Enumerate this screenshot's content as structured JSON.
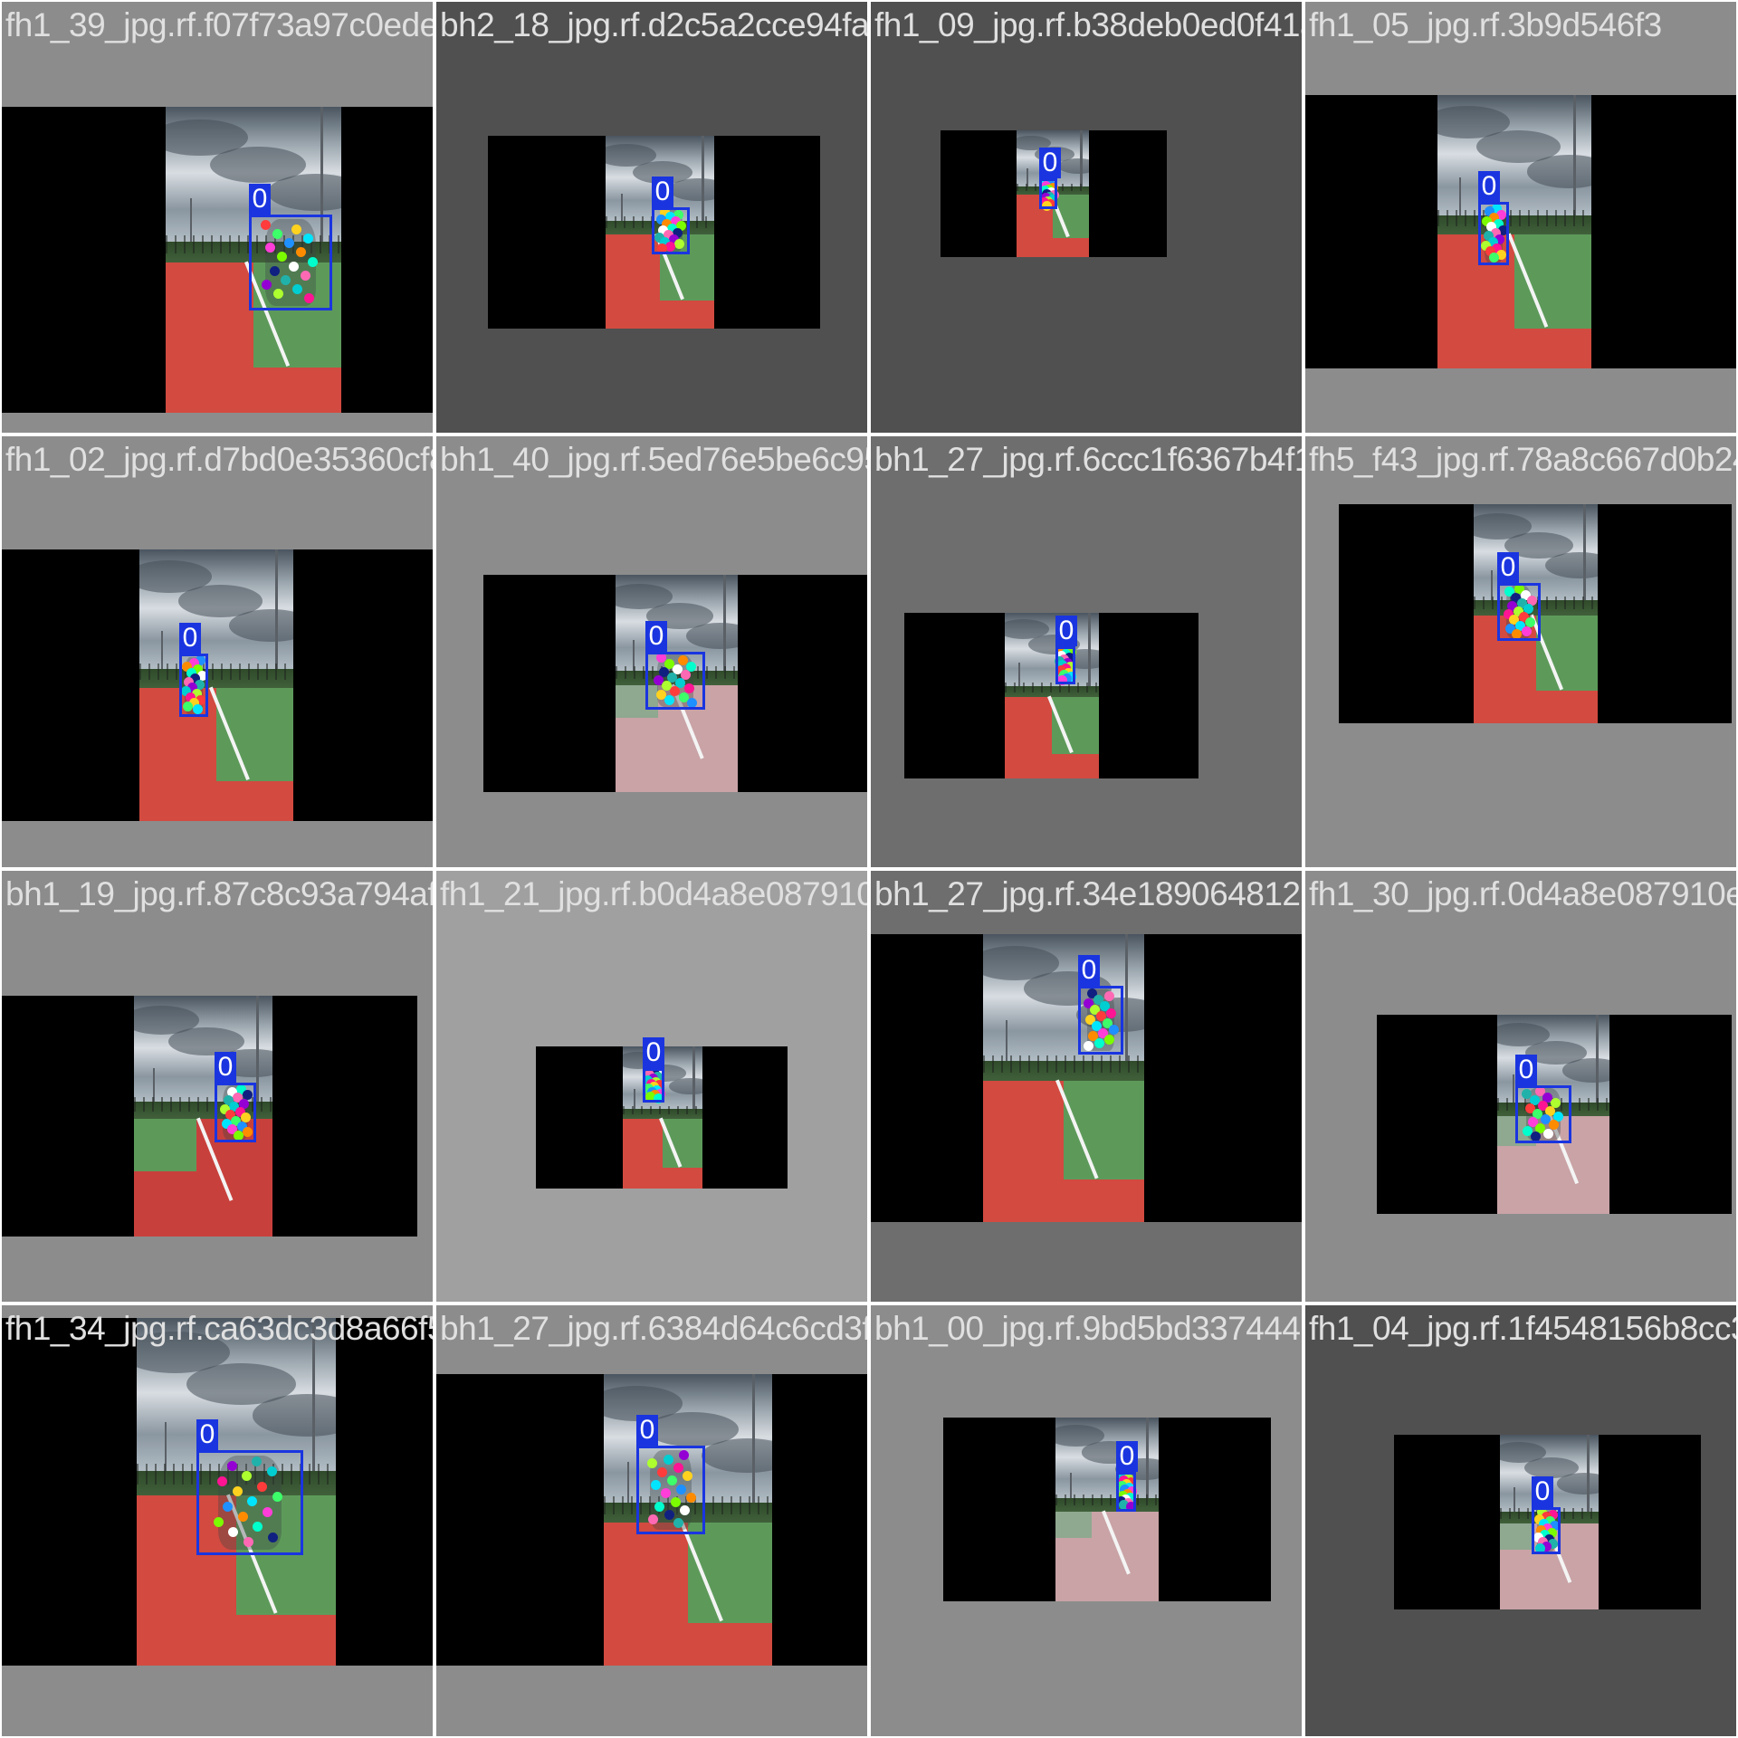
{
  "mosaic": {
    "tiles": [
      {
        "filename": "fh1_39_jpg.rf.f07f73a97c0ede2b2426341b5",
        "background": "#8c8c8c",
        "detection_label": "0",
        "court": "red-green"
      },
      {
        "filename": "bh2_18_jpg.rf.d2c5a2cce94fab029eab4ffa8f",
        "background": "#505050",
        "detection_label": "0",
        "court": "red-green"
      },
      {
        "filename": "fh1_09_jpg.rf.b38deb0ed0f41a054e2963d",
        "background": "#505050",
        "detection_label": "0",
        "court": "red-green"
      },
      {
        "filename": "fh1_05_jpg.rf.3b9d546f3",
        "background": "#8c8c8c",
        "detection_label": "0",
        "court": "red-green"
      },
      {
        "filename": "fh1_02_jpg.rf.d7bd0e35360cf8d74a5590f47",
        "background": "#8c8c8c",
        "detection_label": "0",
        "court": "red-green"
      },
      {
        "filename": "bh1_40_jpg.rf.5ed76e5be6c95fdff6179f22ef",
        "background": "#8c8c8c",
        "detection_label": "0",
        "court": "pink"
      },
      {
        "filename": "bh1_27_jpg.rf.6ccc1f6367b4f1b5c48a5",
        "background": "#6e6e6e",
        "detection_label": "0",
        "court": "red-green"
      },
      {
        "filename": "fh5_f43_jpg.rf.78a8c667d0b24",
        "background": "#8c8c8c",
        "detection_label": "0",
        "court": "red-green"
      },
      {
        "filename": "bh1_19_jpg.rf.87c8c93a794af2142a74196f0d27b3e28901f",
        "background": "#8c8c8c",
        "detection_label": "0",
        "court": "green-red"
      },
      {
        "filename": "fh1_21_jpg.rf.b0d4a8e087910e738561c",
        "background": "#a0a0a0",
        "detection_label": "0",
        "court": "red-green"
      },
      {
        "filename": "bh1_27_jpg.rf.34e1890648123",
        "background": "#6e6e6e",
        "detection_label": "0",
        "court": "red-green"
      },
      {
        "filename": "fh1_30_jpg.rf.0d4a8e087910e738561c274",
        "background": "#8c8c8c",
        "detection_label": "0",
        "court": "pink"
      },
      {
        "filename": "fh1_34_jpg.rf.ca63dc3d8a66f5f0924a9fcf2a7384d64c6cd3",
        "background": "#8c8c8c",
        "detection_label": "0",
        "court": "red-green"
      },
      {
        "filename": "bh1_27_jpg.rf.6384d64c6cd3fb180d0809",
        "background": "#8c8c8c",
        "detection_label": "0",
        "court": "red-green"
      },
      {
        "filename": "bh1_00_jpg.rf.9bd5bd337444954de44",
        "background": "#8c8c8c",
        "detection_label": "0",
        "court": "pink"
      },
      {
        "filename": "fh1_04_jpg.rf.1f4548156b8cc3",
        "background": "#505050",
        "detection_label": "0",
        "court": "pink"
      }
    ],
    "keypoint_colors": [
      "#ff3b3b",
      "#ffd21f",
      "#3cff6a",
      "#00e5ff",
      "#1e90ff",
      "#ff3dd8",
      "#ff8c00",
      "#7cfc00",
      "#00ffcc",
      "#ffffff",
      "#102080",
      "#ff69b4",
      "#20b2aa",
      "#9400d3",
      "#00ced1",
      "#adff2f",
      "#ff1493"
    ]
  }
}
